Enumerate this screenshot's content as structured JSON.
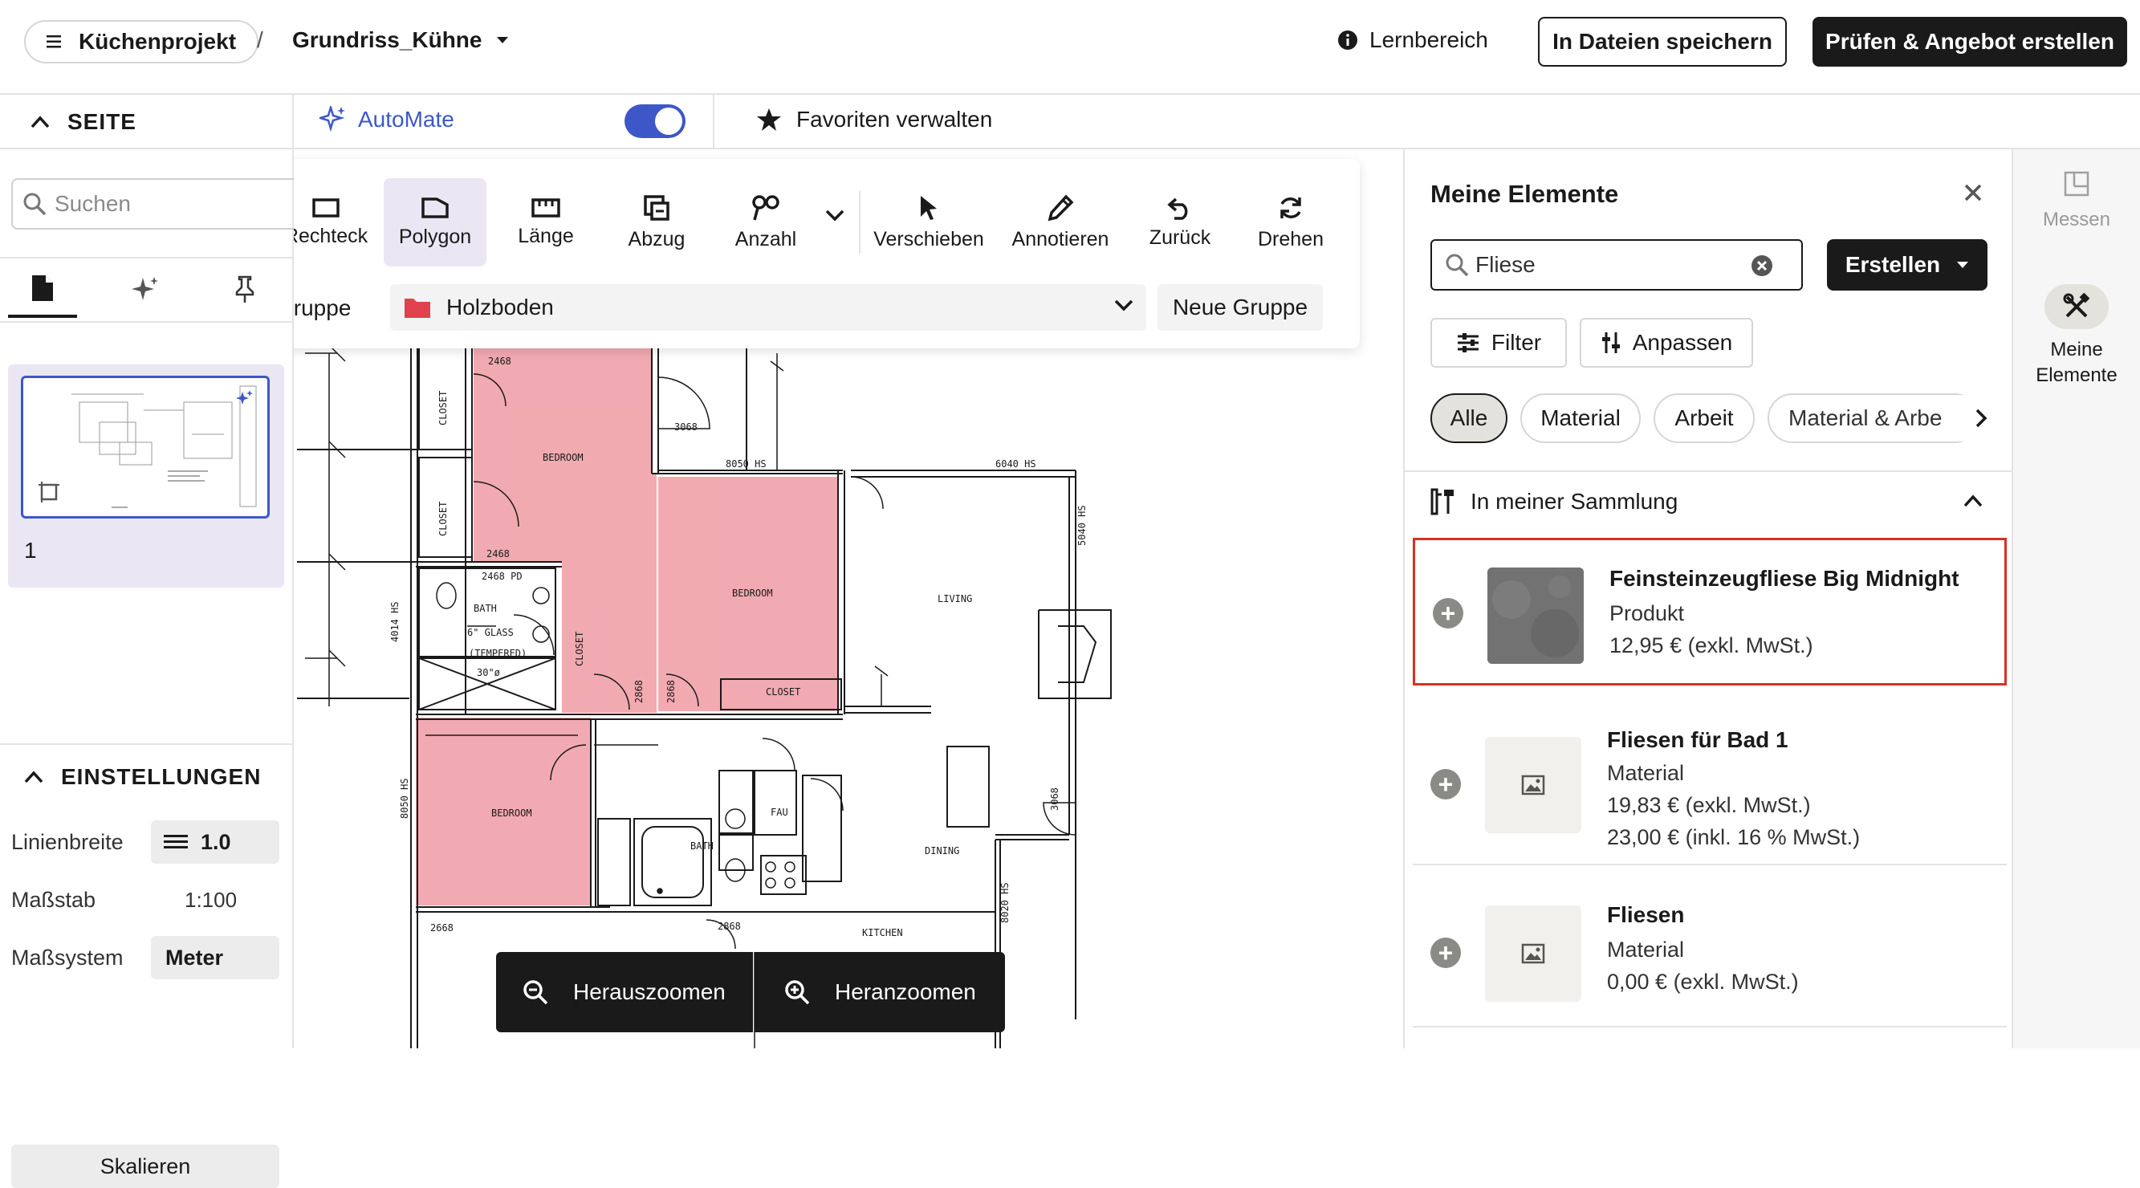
{
  "topbar": {
    "project": "Küchenprojekt",
    "separator": "/",
    "file": "Grundriss_Kühne",
    "learn": "Lernbereich",
    "save": "In Dateien speichern",
    "check": "Prüfen & Angebot erstellen"
  },
  "secbar": {
    "page_section": "SEITE",
    "automate": "AutoMate",
    "automate_on": true,
    "favorites": "Favoriten verwalten"
  },
  "toolbar": {
    "tools": [
      {
        "label": "Rechteck",
        "icon": "rectangle-icon"
      },
      {
        "label": "Polygon",
        "icon": "polygon-icon",
        "active": true
      },
      {
        "label": "Länge",
        "icon": "ruler-icon"
      },
      {
        "label": "Abzug",
        "icon": "deduct-icon"
      },
      {
        "label": "Anzahl",
        "icon": "count-icon"
      },
      {
        "label": "Verschieben",
        "icon": "cursor-icon"
      },
      {
        "label": "Annotieren",
        "icon": "pen-icon"
      },
      {
        "label": "Zurück",
        "icon": "undo-icon"
      },
      {
        "label": "Drehen",
        "icon": "rotate-icon"
      }
    ],
    "group_label": "Gruppe",
    "group_value": "Holzboden",
    "new_group": "Neue Gruppe"
  },
  "left": {
    "search_placeholder": "Suchen",
    "page_number": "1",
    "settings": "EINSTELLUNGEN",
    "line_width_label": "Linienbreite",
    "line_width_value": "1.0",
    "scale_label": "Maßstab",
    "scale_value": "1:100",
    "system_label": "Maßsystem",
    "system_value": "Meter",
    "scale_button": "Skalieren"
  },
  "zoom": {
    "out": "Herauszoomen",
    "in": "Heranzoomen"
  },
  "right": {
    "title": "Meine Elemente",
    "search_value": "Fliese",
    "create": "Erstellen",
    "filter": "Filter",
    "adjust": "Anpassen",
    "chips": [
      "Alle",
      "Material",
      "Arbeit",
      "Material & Arbe"
    ],
    "collection": "In meiner Sammlung",
    "items": [
      {
        "title": "Feinsteinzeugfliese Big Midnight",
        "type": "Produkt",
        "price": "12,95 € (exkl. MwSt.)",
        "price2": ""
      },
      {
        "title": "Fliesen für Bad 1",
        "type": "Material",
        "price": "19,83 € (exkl. MwSt.)",
        "price2": "23,00 € (inkl. 16 % MwSt.)"
      },
      {
        "title": "Fliesen",
        "type": "Material",
        "price": "0,00 € (exkl. MwSt.)",
        "price2": ""
      }
    ]
  },
  "farright": {
    "measure": "Messen",
    "my_elements": "Meine Elemente"
  },
  "plan": {
    "labels": {
      "bedroom1": "BEDROOM",
      "bedroom2": "BEDROOM",
      "bedroom3": "BEDROOM",
      "closet1": "CLOSET",
      "closet2": "CLOSET",
      "closet3": "CLOSET",
      "closet4": "CLOSET",
      "bath1": "BATH",
      "bath2": "BATH",
      "living": "LIVING",
      "dining": "DINING",
      "kitchen": "KITCHEN",
      "fau": "FAU",
      "d2468a": "2468",
      "d2468b": "2468",
      "d2468pd": "2468 PD",
      "d3068a": "3068",
      "d3068b": "3068",
      "d2868a": "2868",
      "d2868b": "2868",
      "d2668": "2668",
      "d2868c": "2868",
      "hs8050a": "8050 HS",
      "hs6040": "6040 HS",
      "hs5040": "5040 HS",
      "hs4014": "4014 HS",
      "hs8050b": "8050 HS",
      "hs8020": "8020 HS",
      "glass": "6\" GLASS",
      "tempered": "(TEMPERED)",
      "d30": "30\"ø"
    }
  },
  "colors": {
    "accent": "#3d57c9",
    "room_fill": "#f0a3aa",
    "highlight": "#d93025",
    "dark": "#1a1a1a"
  }
}
